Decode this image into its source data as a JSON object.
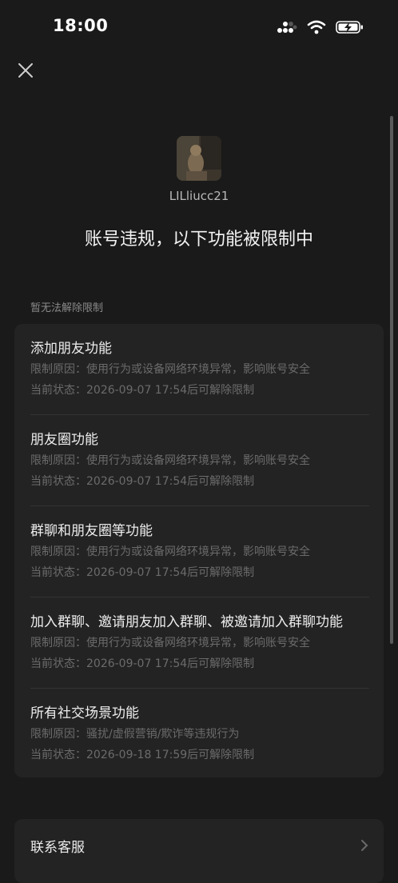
{
  "status_bar": {
    "time": "18:00"
  },
  "user": {
    "username": "LILliucc21"
  },
  "headline": "账号违规，以下功能被限制中",
  "section_label": "暂无法解除限制",
  "restrictions": [
    {
      "title": "添加朋友功能",
      "reason": "限制原因：使用行为或设备网络环境异常，影响账号安全",
      "status": "当前状态：2026-09-07 17:54后可解除限制"
    },
    {
      "title": "朋友圈功能",
      "reason": "限制原因：使用行为或设备网络环境异常，影响账号安全",
      "status": "当前状态：2026-09-07 17:54后可解除限制"
    },
    {
      "title": "群聊和朋友圈等功能",
      "reason": "限制原因：使用行为或设备网络环境异常，影响账号安全",
      "status": "当前状态：2026-09-07 17:54后可解除限制"
    },
    {
      "title": "加入群聊、邀请朋友加入群聊、被邀请加入群聊功能",
      "reason": "限制原因：使用行为或设备网络环境异常，影响账号安全",
      "status": "当前状态：2026-09-07 17:54后可解除限制"
    },
    {
      "title": "所有社交场景功能",
      "reason": "限制原因：骚扰/虚假营销/欺诈等违规行为",
      "status": "当前状态：2026-09-18 17:59后可解除限制"
    }
  ],
  "contact_service": {
    "label": "联系客服"
  },
  "icons": [
    "close-icon",
    "signal-icon",
    "wifi-icon",
    "battery-charging-icon",
    "chevron-right-icon"
  ],
  "colors": {
    "background": "#1a1a1a",
    "card": "#232323",
    "muted_text": "#6b6b6b"
  }
}
